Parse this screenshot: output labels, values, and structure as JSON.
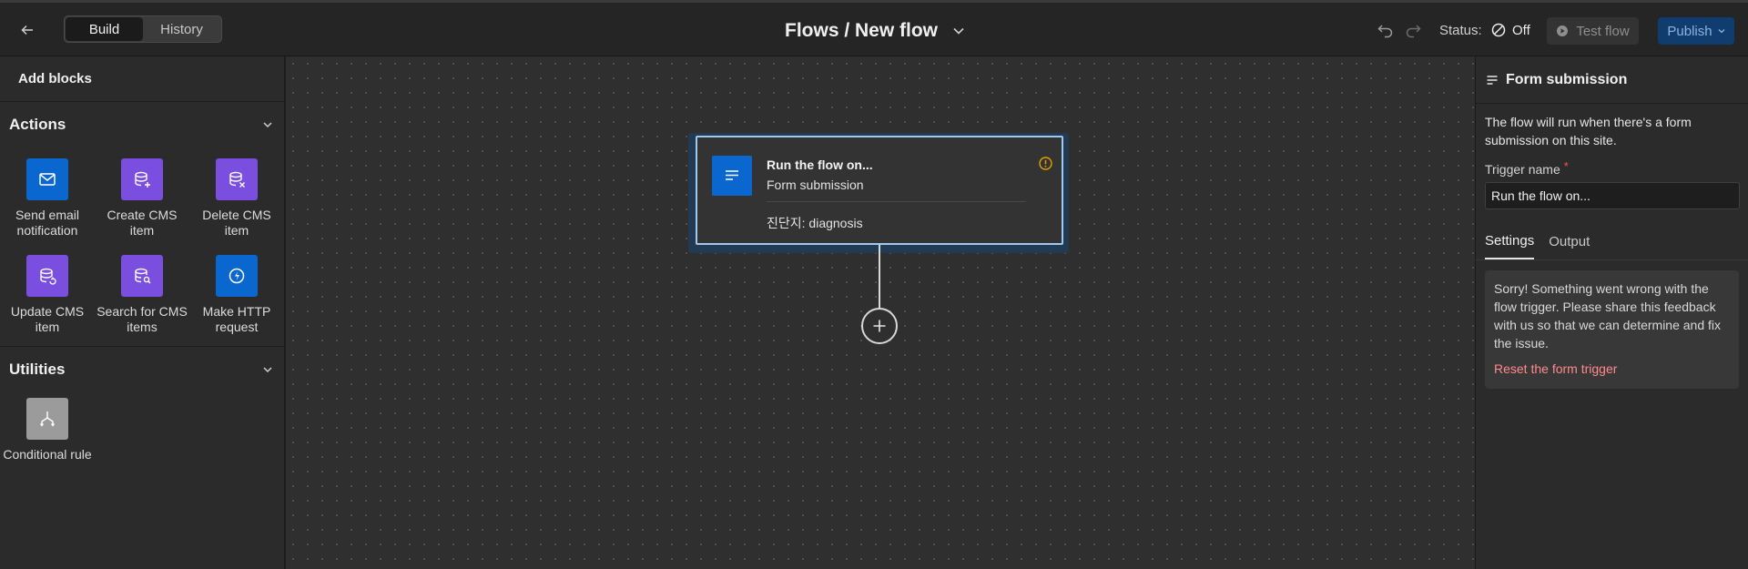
{
  "header": {
    "tabs": [
      {
        "label": "Build"
      },
      {
        "label": "History"
      }
    ],
    "title": "Flows / New flow",
    "status_label": "Status:",
    "status_value": "Off",
    "test_label": "Test flow",
    "publish_label": "Publish"
  },
  "left_panel": {
    "title": "Add blocks",
    "sections": [
      {
        "title": "Actions",
        "blocks": [
          {
            "label": "Send email notification",
            "icon": "mail-icon"
          },
          {
            "label": "Create CMS item",
            "icon": "database-plus-icon"
          },
          {
            "label": "Delete CMS item",
            "icon": "database-x-icon"
          },
          {
            "label": "Update CMS item",
            "icon": "database-update-icon"
          },
          {
            "label": "Search for CMS items",
            "icon": "database-search-icon"
          },
          {
            "label": "Make HTTP request",
            "icon": "globe-lightning-icon"
          }
        ]
      },
      {
        "title": "Utilities",
        "blocks": [
          {
            "label": "Conditional rule",
            "icon": "branch-icon"
          }
        ]
      }
    ]
  },
  "canvas": {
    "node": {
      "title": "Run the flow on...",
      "subtitle": "Form submission",
      "field": "진단지: diagnosis"
    }
  },
  "right_panel": {
    "title": "Form submission",
    "description": "The flow will run when there's a form submission on this site.",
    "trigger_label": "Trigger name",
    "required_mark": "*",
    "trigger_value": "Run the flow on...",
    "tabs": [
      {
        "label": "Settings"
      },
      {
        "label": "Output"
      }
    ],
    "alert_text": "Sorry! Something went wrong with the flow trigger. Please share this feedback with us so that we can determine and fix the issue.",
    "alert_link": "Reset the form trigger"
  },
  "colors": {
    "accent_blue": "#0a67d0",
    "cms_purple": "#7a4fe0",
    "node_border": "#9fc9ef",
    "error_link": "#ff8a8a"
  }
}
